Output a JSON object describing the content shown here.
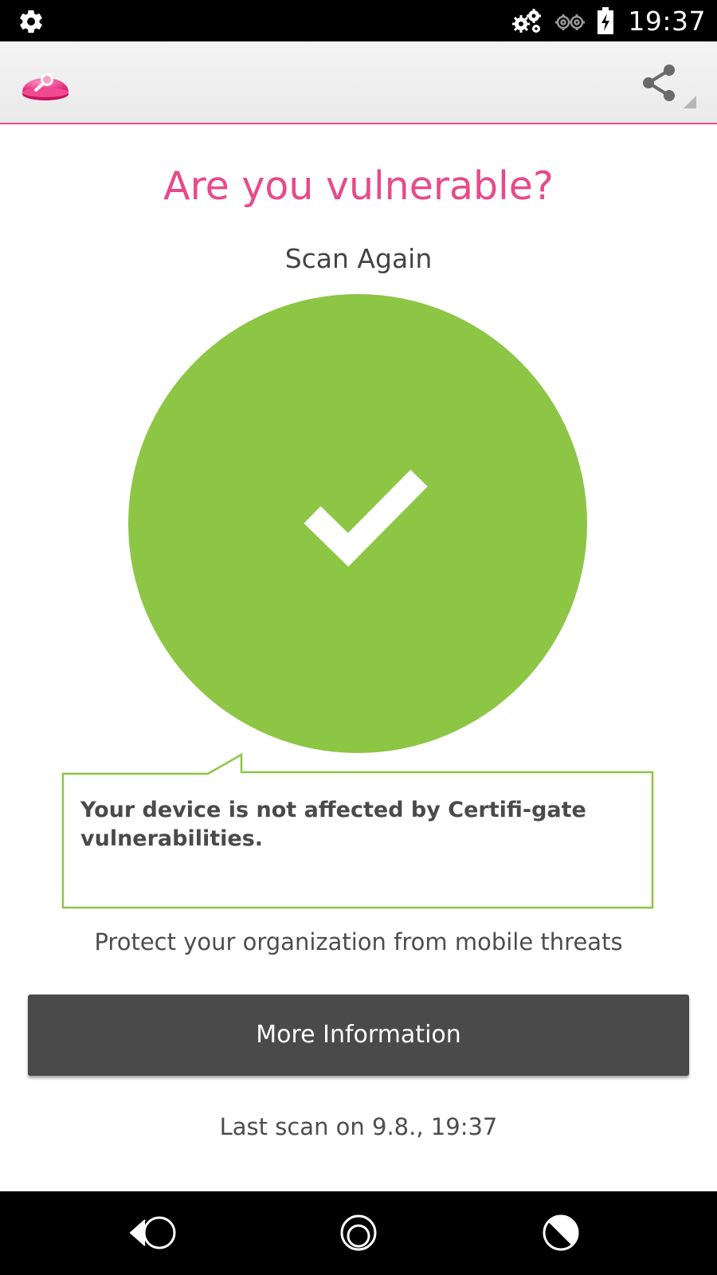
{
  "status_bar": {
    "time": "19:37",
    "icons": [
      "settings-gear-icon",
      "gears-icon",
      "gears-outline-icon",
      "battery-charging-icon"
    ]
  },
  "app_bar": {
    "logo": "app-logo",
    "actions": [
      "share-icon"
    ],
    "accent_color": "#e94b86"
  },
  "main": {
    "title": "Are you vulnerable?",
    "scan_again_label": "Scan Again",
    "result": {
      "icon": "checkmark-icon",
      "circle_color": "#8dc545",
      "message": "Your device is not affected by Certifi-gate vulnerabilities."
    },
    "tagline": "Protect your organization from mobile threats",
    "more_info_label": "More Information",
    "last_scan": "Last scan on 9.8., 19:37"
  },
  "nav_bar": {
    "buttons": [
      "back-icon",
      "home-icon",
      "recents-icon"
    ]
  }
}
